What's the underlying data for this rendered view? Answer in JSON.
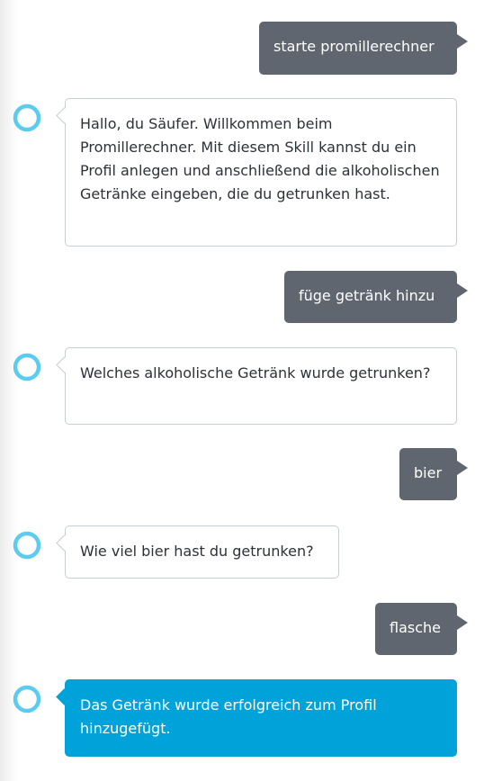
{
  "conversation": {
    "messages": [
      {
        "speaker": "user",
        "text": "starte promillerechner"
      },
      {
        "speaker": "alexa",
        "text": "Hallo, du Säufer. Willkommen beim Promillerechner. Mit diesem Skill kannst du ein Profil anlegen und anschließend die alkoholischen Getränke eingeben, die du getrunken hast."
      },
      {
        "speaker": "user",
        "text": "füge getränk hinzu"
      },
      {
        "speaker": "alexa",
        "text": "Welches alkoholische Getränk wurde getrunken?"
      },
      {
        "speaker": "user",
        "text": "bier"
      },
      {
        "speaker": "alexa",
        "text": "Wie viel bier hast du getrunken?"
      },
      {
        "speaker": "user",
        "text": "flasche"
      },
      {
        "speaker": "alexa",
        "text": "Das Getränk wurde erfolgreich zum Profil hinzugefügt.",
        "highlighted": true
      }
    ]
  },
  "colors": {
    "user_bubble": "#5f6670",
    "alexa_border": "#c6cdd4",
    "alexa_highlight": "#00a3d9",
    "alexa_ring": "#5ccbf0"
  },
  "icons": {
    "alexa_avatar": "alexa-ring-icon"
  }
}
